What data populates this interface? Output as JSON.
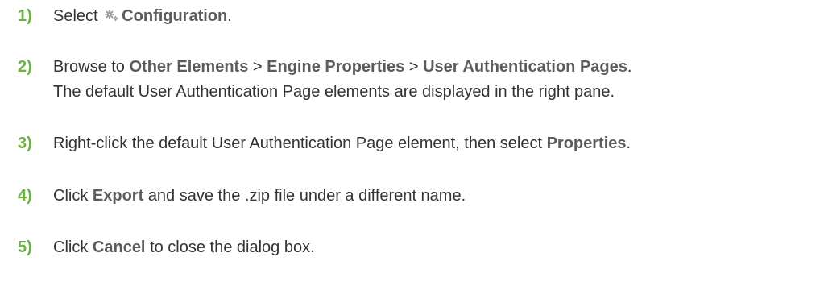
{
  "steps": [
    {
      "number": "1)",
      "pre": "Select",
      "icon": "gear-icon",
      "bold": "Configuration",
      "post": "."
    },
    {
      "number": "2)",
      "pre": "Browse to",
      "path": [
        "Other Elements",
        "Engine Properties",
        "User Authentication Pages"
      ],
      "separator": ">",
      "post": ".",
      "line2": "The default User Authentication Page elements are displayed in the right pane."
    },
    {
      "number": "3)",
      "pre": "Right-click the default User Authentication Page element, then select",
      "bold": "Properties",
      "post": "."
    },
    {
      "number": "4)",
      "pre": "Click",
      "bold": "Export",
      "post": "and save the .zip file under a different name."
    },
    {
      "number": "5)",
      "pre": "Click",
      "bold": "Cancel",
      "post": "to close the dialog box."
    }
  ],
  "colors": {
    "step_number": "#6cb33f",
    "text": "#333333",
    "ui_term": "#5c5c5c",
    "icon": "#8a8a8a"
  }
}
